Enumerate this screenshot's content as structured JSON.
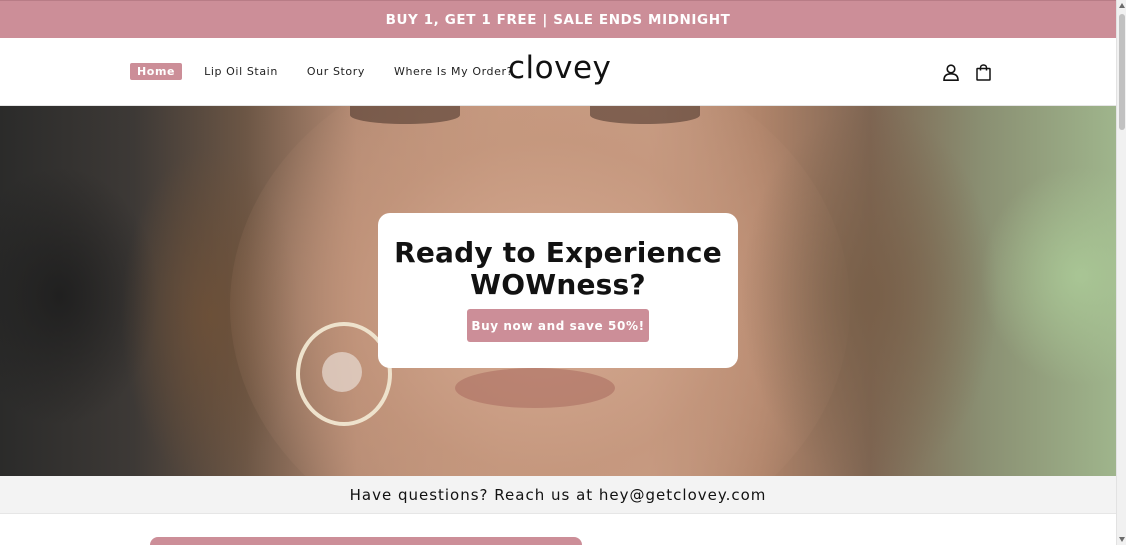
{
  "announcement": {
    "text": "BUY 1, GET 1 FREE | SALE ENDS MIDNIGHT"
  },
  "header": {
    "logo": "clovey",
    "nav": [
      {
        "label": "Home",
        "active": true
      },
      {
        "label": "Lip Oil Stain",
        "active": false
      },
      {
        "label": "Our Story",
        "active": false
      },
      {
        "label": "Where Is My Order?",
        "active": false
      }
    ],
    "icons": [
      "account-icon",
      "cart-icon"
    ]
  },
  "hero": {
    "title_line1": "Ready to Experience",
    "title_line2": "WOWness?",
    "button_label": "Buy now and save 50%!"
  },
  "contact": {
    "text": "Have questions? Reach us at hey@getclovey.com"
  },
  "colors": {
    "accent": "#cc8e98",
    "contact_bg": "#f3f3f3",
    "text": "#121212"
  }
}
